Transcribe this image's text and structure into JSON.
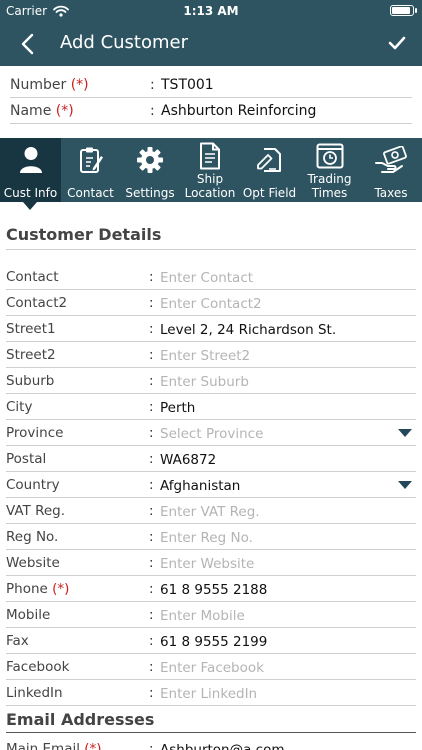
{
  "status_bar": {
    "carrier": "Carrier",
    "time": "1:13 AM"
  },
  "nav": {
    "title": "Add Customer",
    "back_icon": "chevron-left-icon",
    "save_icon": "checkmark-icon"
  },
  "header_fields": [
    {
      "label": "Number",
      "required": "(*)",
      "value": "TST001"
    },
    {
      "label": "Name",
      "required": "(*)",
      "value": "Ashburton Reinforcing"
    }
  ],
  "tabs": [
    {
      "label": "Cust Info",
      "label2": "",
      "icon": "person-icon",
      "active": true
    },
    {
      "label": "Contact",
      "label2": "",
      "icon": "clipboard-edit-icon"
    },
    {
      "label": "Settings",
      "label2": "",
      "icon": "gear-icon"
    },
    {
      "label": "Ship",
      "label2": "Location",
      "icon": "document-icon"
    },
    {
      "label": "Opt Field",
      "label2": "",
      "icon": "edit-document-icon"
    },
    {
      "label": "Trading",
      "label2": "Times",
      "icon": "clock-icon"
    },
    {
      "label": "Taxes",
      "label2": "",
      "icon": "money-hand-icon"
    }
  ],
  "customer_details": {
    "title": "Customer Details",
    "fields": [
      {
        "label": "Contact",
        "value": "",
        "placeholder": "Enter Contact"
      },
      {
        "label": "Contact2",
        "value": "",
        "placeholder": "Enter Contact2"
      },
      {
        "label": "Street1",
        "value": "Level 2, 24 Richardson St.",
        "placeholder": ""
      },
      {
        "label": "Street2",
        "value": "",
        "placeholder": "Enter Street2"
      },
      {
        "label": "Suburb",
        "value": "",
        "placeholder": "Enter Suburb"
      },
      {
        "label": "City",
        "value": "Perth",
        "placeholder": ""
      },
      {
        "label": "Province",
        "value": "",
        "placeholder": "Select Province",
        "dropdown": true
      },
      {
        "label": "Postal",
        "value": "WA6872",
        "placeholder": ""
      },
      {
        "label": "Country",
        "value": "Afghanistan",
        "placeholder": "",
        "dropdown": true
      },
      {
        "label": "VAT Reg.",
        "value": "",
        "placeholder": "Enter VAT Reg."
      },
      {
        "label": "Reg No.",
        "value": "",
        "placeholder": "Enter Reg No."
      },
      {
        "label": "Website",
        "value": "",
        "placeholder": "Enter Website"
      },
      {
        "label": "Phone",
        "required": "(*)",
        "value": "61 8 9555 2188",
        "placeholder": ""
      },
      {
        "label": "Mobile",
        "value": "",
        "placeholder": "Enter Mobile"
      },
      {
        "label": "Fax",
        "value": "61 8 9555 2199",
        "placeholder": ""
      },
      {
        "label": "Facebook",
        "value": "",
        "placeholder": "Enter Facebook"
      },
      {
        "label": "LinkedIn",
        "value": "",
        "placeholder": "Enter LinkedIn"
      }
    ]
  },
  "email_addresses": {
    "title": "Email Addresses",
    "fields": [
      {
        "label": "Main Email",
        "required": "(*)",
        "value": "Ashburton@a.com",
        "placeholder": ""
      }
    ]
  },
  "colors": {
    "header": "#2e5461",
    "active_tab": "#173642",
    "required": "#cc1f1f",
    "placeholder": "#b4b4b4"
  }
}
